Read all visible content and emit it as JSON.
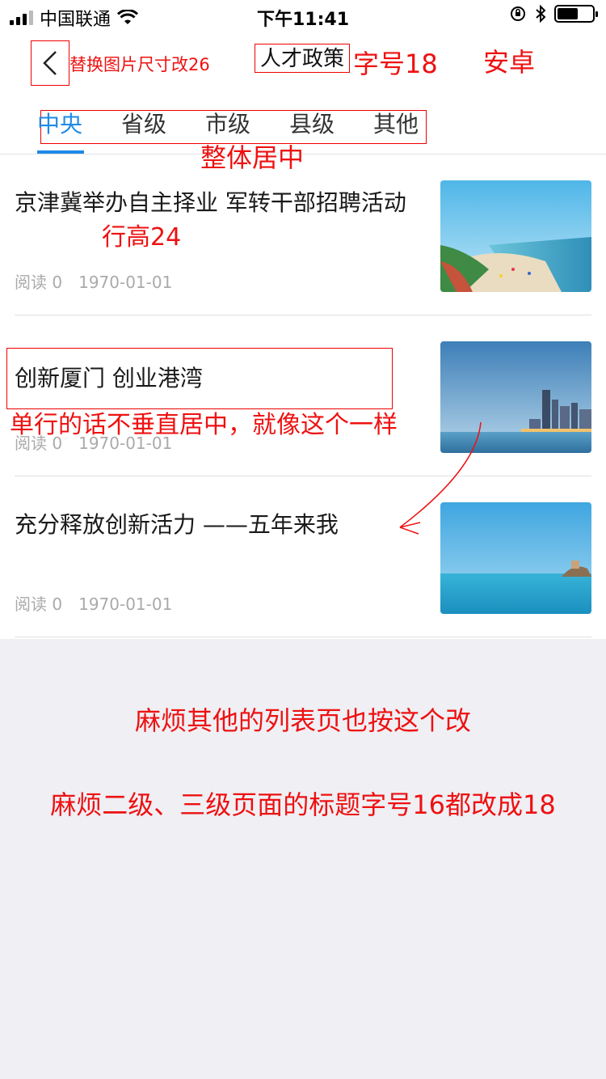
{
  "status_bar": {
    "carrier": "中国联通",
    "time": "下午11:41",
    "battery_level": 0.6
  },
  "nav": {
    "back_icon": "chevron-left-icon",
    "title": "人才政策"
  },
  "tabs": [
    {
      "label": "中央",
      "active": true
    },
    {
      "label": "省级",
      "active": false
    },
    {
      "label": "市级",
      "active": false
    },
    {
      "label": "县级",
      "active": false
    },
    {
      "label": "其他",
      "active": false
    }
  ],
  "articles": [
    {
      "title": "京津冀举办自主择业 军转干部招聘活动",
      "read_label": "阅读 0",
      "date": "1970-01-01",
      "thumb": "beach-coast-photo"
    },
    {
      "title": "创新厦门 创业港湾",
      "read_label": "阅读 0",
      "date": "1970-01-01",
      "thumb": "city-skyline-photo"
    },
    {
      "title": "充分释放创新活力 ——五年来我",
      "read_label": "阅读 0",
      "date": "1970-01-01",
      "thumb": "sea-island-photo"
    }
  ],
  "annotations": {
    "back": "替换图片尺寸改26",
    "font18": "字号18",
    "android": "安卓",
    "center": "整体居中",
    "line_height": "行高24",
    "single_line": "单行的话不垂直居中，就像这个一样",
    "others": "麻烦其他的列表页也按这个改",
    "title_font": "麻烦二级、三级页面的标题字号16都改成18"
  },
  "colors": {
    "accent": "#1e8ae6",
    "annotation": "#ee1111",
    "background": "#efeff4"
  }
}
